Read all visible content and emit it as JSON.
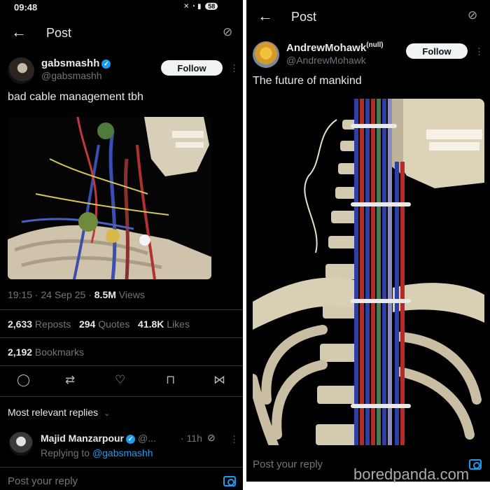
{
  "left": {
    "status_time": "09:48",
    "battery": "58",
    "header": {
      "title": "Post"
    },
    "author": {
      "display_name": "gabsmashh",
      "handle": "@gabsmashh"
    },
    "follow_label": "Follow",
    "post_text": "bad cable management tbh",
    "meta": {
      "time_date": "19:15 · 24 Sep 25 · ",
      "views_count": "8.5M",
      "views_label": " Views"
    },
    "stats": {
      "reposts_count": "2,633",
      "reposts_label": " Reposts",
      "quotes_count": "294",
      "quotes_label": " Quotes",
      "likes_count": "41.8K",
      "likes_label": " Likes",
      "bookmarks_count": "2,192",
      "bookmarks_label": " Bookmarks"
    },
    "replies_sort": "Most relevant replies",
    "reply": {
      "name": "Majid Manzarpour",
      "handle": "@...",
      "time": "· 11h",
      "replying_to_label": "Replying to ",
      "replying_to_handle": "@gabsmashh"
    },
    "compose_placeholder": "Post your reply"
  },
  "right": {
    "header": {
      "title": "Post"
    },
    "author": {
      "display_name": "AndrewMohawk",
      "suffix": "(null)",
      "handle": "@AndrewMohawk"
    },
    "follow_label": "Follow",
    "post_text": "The future of mankind",
    "compose_placeholder": "Post your reply"
  },
  "watermark": {
    "brand": "bored",
    "brand2": "panda.com"
  },
  "colors": {
    "background": "#000000",
    "text": "#e7e9ea",
    "secondary": "#71767b",
    "accent": "#1d9bf0",
    "follow_bg": "#eff3f4"
  },
  "icons": [
    "back-arrow-icon",
    "grok-icon",
    "verified-badge-icon",
    "more-icon",
    "reply-icon",
    "repost-icon",
    "like-icon",
    "bookmark-icon",
    "share-icon",
    "chevron-down-icon",
    "camera-icon"
  ]
}
